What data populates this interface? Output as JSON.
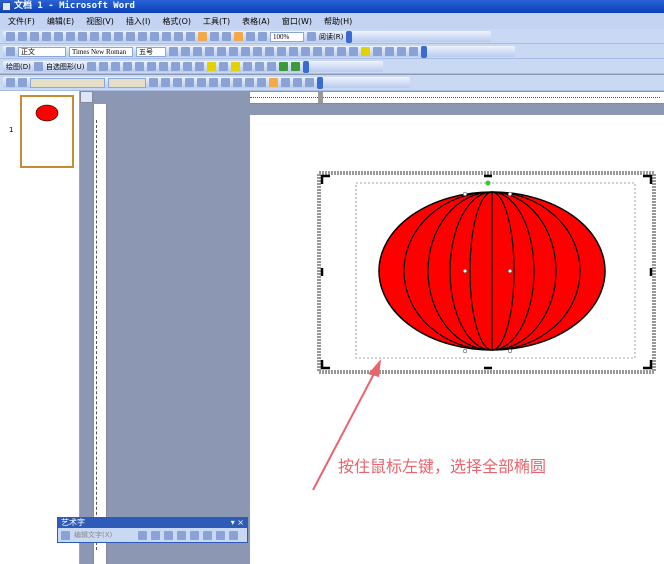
{
  "window": {
    "title": "文档 1 - Microsoft Word"
  },
  "menu": [
    "文件(F)",
    "编辑(E)",
    "视图(V)",
    "插入(I)",
    "格式(O)",
    "工具(T)",
    "表格(A)",
    "窗口(W)",
    "帮助(H)"
  ],
  "toolbar": {
    "zoom": "100%",
    "read_label": "阅读(R)",
    "style": "正文",
    "font": "Times New Roman",
    "size": "五号",
    "draw_label": "绘图(D)",
    "autoshape_label": "自选图形(U)"
  },
  "thumbnail": {
    "page_number": "1"
  },
  "annotation": {
    "text": "按住鼠标左键，选择全部椭圆",
    "color": "#e8646e"
  },
  "shape": {
    "fill": "#ff0000"
  },
  "wordart_toolbar": {
    "title": "艺术字",
    "edit_text": "编辑文字(X)"
  }
}
